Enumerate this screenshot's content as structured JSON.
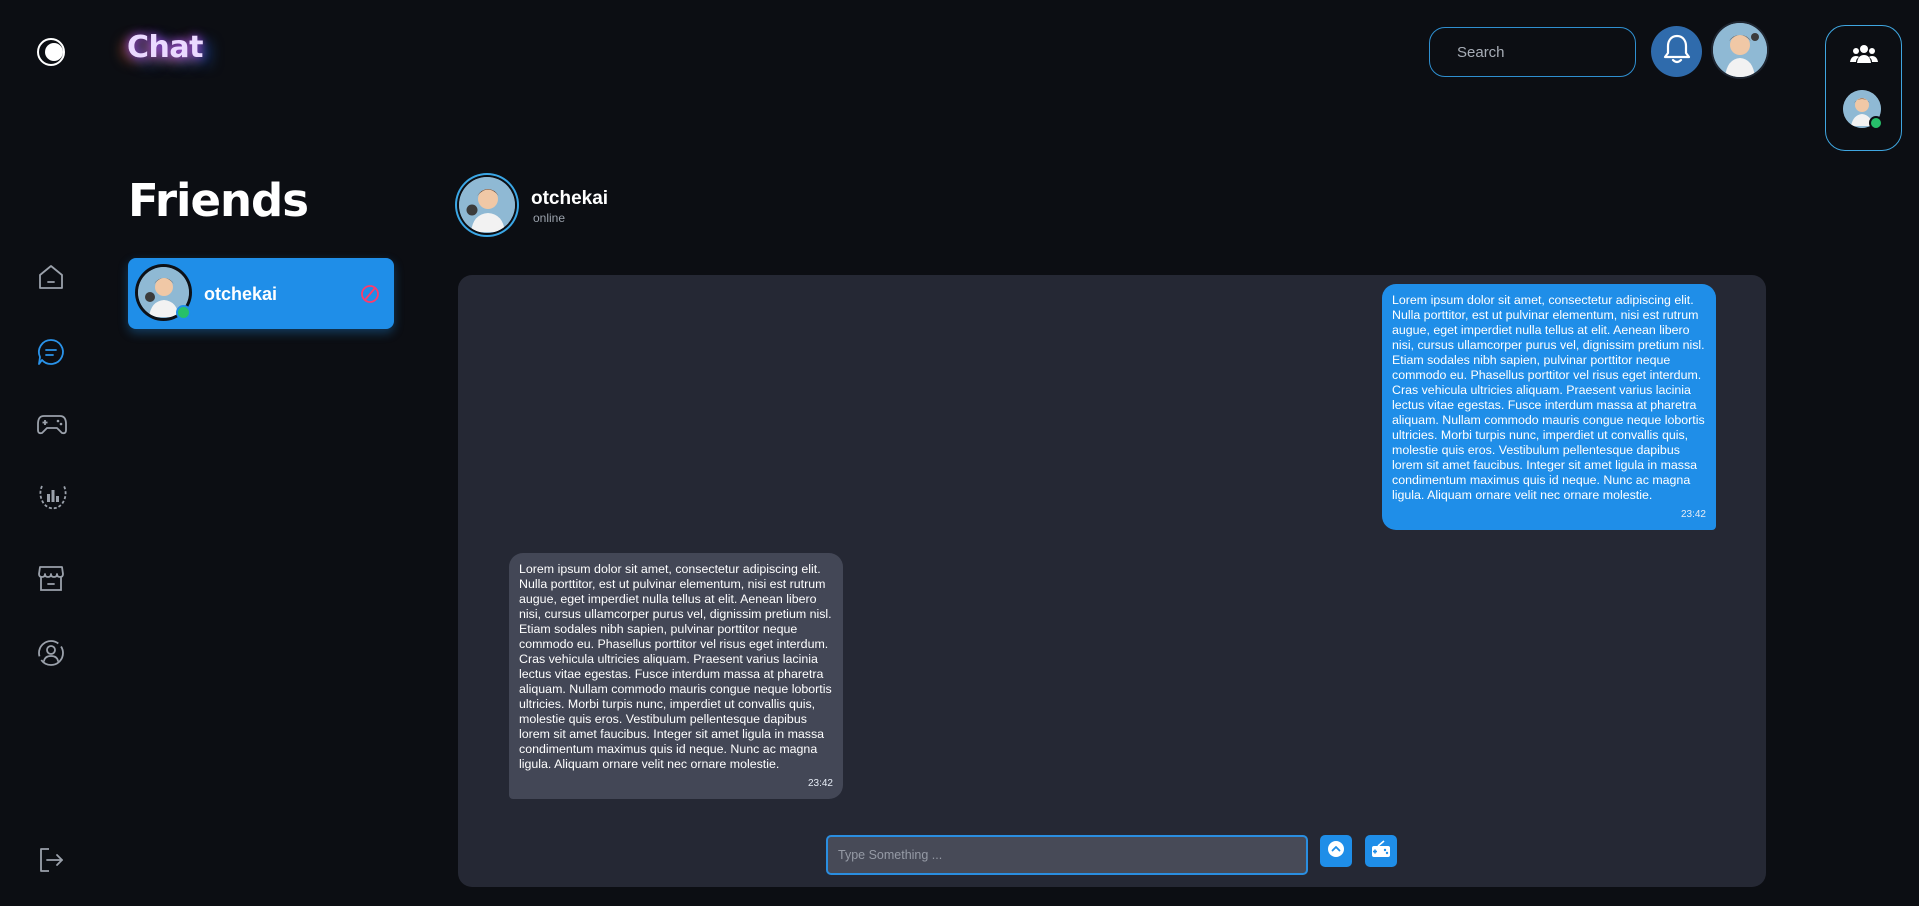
{
  "header": {
    "app_title": "Chat",
    "search_placeholder": "Search"
  },
  "sidebar": {
    "items": [
      {
        "icon": "home-icon",
        "active": false
      },
      {
        "icon": "chat-icon",
        "active": true
      },
      {
        "icon": "gamepad-icon",
        "active": false
      },
      {
        "icon": "leaderboard-icon",
        "active": false
      },
      {
        "icon": "store-icon",
        "active": false
      },
      {
        "icon": "profile-icon",
        "active": false
      }
    ],
    "logout_icon": "logout-icon"
  },
  "friends": {
    "heading": "Friends",
    "list": [
      {
        "name": "otchekai",
        "status": "online"
      }
    ]
  },
  "chat": {
    "name": "otchekai",
    "status": "online",
    "messages": [
      {
        "direction": "sent",
        "text": "Lorem ipsum dolor sit amet, consectetur adipiscing elit. Nulla porttitor, est ut pulvinar elementum, nisi est rutrum augue, eget imperdiet nulla tellus at elit. Aenean libero nisi, cursus ullamcorper purus vel, dignissim pretium nisl. Etiam sodales nibh sapien, pulvinar porttitor neque commodo eu. Phasellus porttitor vel risus eget interdum. Cras vehicula ultricies aliquam. Praesent varius lacinia lectus vitae egestas. Fusce interdum massa at pharetra aliquam. Nullam commodo mauris congue neque lobortis ultricies. Morbi turpis nunc, imperdiet ut convallis quis, molestie quis eros. Vestibulum pellentesque dapibus lorem sit amet faucibus. Integer sit amet ligula in massa condimentum maximus quis id neque. Nunc ac magna ligula. Aliquam ornare velit nec ornare molestie.",
        "time": "23:42"
      },
      {
        "direction": "received",
        "text": "Lorem ipsum dolor sit amet, consectetur adipiscing elit. Nulla porttitor, est ut pulvinar elementum, nisi est rutrum augue, eget imperdiet nulla tellus at elit. Aenean libero nisi, cursus ullamcorper purus vel, dignissim pretium nisl. Etiam sodales nibh sapien, pulvinar porttitor neque commodo eu. Phasellus porttitor vel risus eget interdum. Cras vehicula ultricies aliquam. Praesent varius lacinia lectus vitae egestas. Fusce interdum massa at pharetra aliquam. Nullam commodo mauris congue neque lobortis ultricies. Morbi turpis nunc, imperdiet ut convallis quis, molestie quis eros. Vestibulum pellentesque dapibus lorem sit amet faucibus. Integer sit amet ligula in massa condimentum maximus quis id neque. Nunc ac magna ligula. Aliquam ornare velit nec ornare molestie.",
        "time": "23:42"
      }
    ],
    "input_placeholder": "Type Something ..."
  },
  "colors": {
    "background": "#0c0e13",
    "accent": "#1f8ee8",
    "chat_panel": "#252834",
    "received_bubble": "#434756",
    "online": "#27c06a",
    "block": "#ff3b6b"
  }
}
